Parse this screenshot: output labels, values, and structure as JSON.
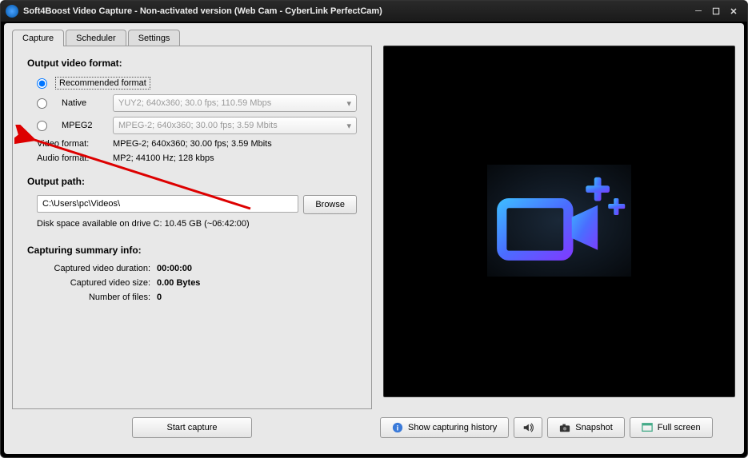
{
  "titlebar": {
    "title": "Soft4Boost Video Capture - Non-activated version (Web Cam - CyberLink PerfectCam)"
  },
  "tabs": {
    "capture": "Capture",
    "scheduler": "Scheduler",
    "settings": "Settings"
  },
  "format": {
    "section": "Output video format:",
    "recommended": "Recommended format",
    "native": "Native",
    "native_combo": "YUY2; 640x360; 30.0 fps; 110.59 Mbps",
    "mpeg2": "MPEG2",
    "mpeg2_combo": "MPEG-2; 640x360; 30.00 fps; 3.59 Mbits",
    "video_format_label": "Video format:",
    "video_format_value": "MPEG-2; 640x360; 30.00 fps; 3.59 Mbits",
    "audio_format_label": "Audio format:",
    "audio_format_value": "MP2; 44100 Hz; 128 kbps"
  },
  "output": {
    "section": "Output path:",
    "path": "C:\\Users\\pc\\Videos\\",
    "browse": "Browse",
    "disk": "Disk space available on drive C: 10.45 GB (~06:42:00)"
  },
  "summary": {
    "section": "Capturing summary info:",
    "duration_label": "Captured video duration:",
    "duration_value": "00:00:00",
    "size_label": "Captured video size:",
    "size_value": "0.00 Bytes",
    "files_label": "Number of files:",
    "files_value": "0"
  },
  "buttons": {
    "start": "Start capture",
    "history": "Show capturing history",
    "snapshot": "Snapshot",
    "fullscreen": "Full screen"
  }
}
